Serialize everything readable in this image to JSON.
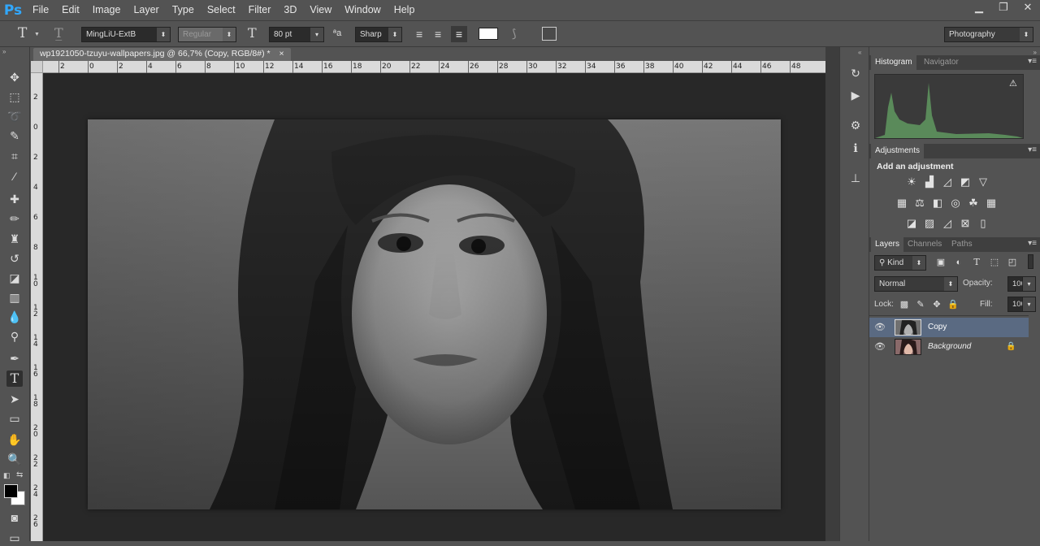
{
  "app": {
    "logo": "Ps"
  },
  "menu": [
    "File",
    "Edit",
    "Image",
    "Layer",
    "Type",
    "Select",
    "Filter",
    "3D",
    "View",
    "Window",
    "Help"
  ],
  "window_controls": [
    "▁",
    "❐",
    "✕"
  ],
  "options": {
    "font_family": "MingLiU-ExtB",
    "font_style": "Regular",
    "font_size": "80 pt",
    "antialias": "Sharp",
    "aa_icon": "ªa",
    "workspace": "Photography"
  },
  "document": {
    "tab_title": "wp1921050-tzuyu-wallpapers.jpg @ 66,7% (Copy, RGB/8#) *",
    "tab_close": "×"
  },
  "rulers": {
    "top": [
      "2",
      "0",
      "2",
      "4",
      "6",
      "8",
      "10",
      "12",
      "14",
      "16",
      "18",
      "20",
      "22",
      "24",
      "26",
      "28",
      "30",
      "32",
      "34",
      "36",
      "38",
      "40",
      "42",
      "44",
      "46",
      "48"
    ],
    "left": [
      "2",
      "0",
      "2",
      "4",
      "6",
      "8",
      "10",
      "12",
      "14",
      "16",
      "18",
      "20",
      "22",
      "24",
      "26"
    ]
  },
  "panels": {
    "histogram": {
      "tabs": [
        "Histogram",
        "Navigator"
      ],
      "warning": "⚠"
    },
    "adjustments": {
      "tab": "Adjustments",
      "heading": "Add an adjustment"
    },
    "layers": {
      "tabs": [
        "Layers",
        "Channels",
        "Paths"
      ],
      "kind_label": "Kind",
      "blend_mode": "Normal",
      "opacity_label": "Opacity:",
      "opacity_value": "100%",
      "lock_label": "Lock:",
      "fill_label": "Fill:",
      "fill_value": "100%",
      "items": [
        {
          "name": "Copy",
          "selected": true,
          "locked": false
        },
        {
          "name": "Background",
          "selected": false,
          "locked": true
        }
      ]
    }
  },
  "colors": {
    "accent": "#31a8ff",
    "selection": "#5a6a82",
    "histogram": "#5a8a5a"
  }
}
